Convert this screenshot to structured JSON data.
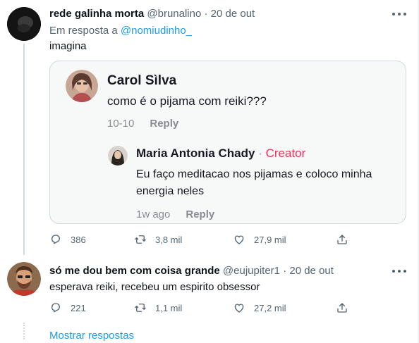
{
  "tweet1": {
    "name": "rede galinha morta",
    "handle": "@brunalino",
    "sep": "·",
    "date": "20 de out",
    "reply_prefix": "Em resposta a",
    "reply_handle": "@nomiudinho_",
    "text": "imagina",
    "media": {
      "comment1": {
        "name": "Carol Sìlva",
        "text": "como é o pijama com reiki???",
        "date": "10-10",
        "reply": "Reply"
      },
      "comment2": {
        "name": "Maria Antonia Chady",
        "dot": "·",
        "creator": "Creator",
        "text": "Eu faço meditacao nos pijamas e coloco minha energia neles",
        "date": "1w ago",
        "reply": "Reply"
      }
    },
    "actions": {
      "replies": "386",
      "retweets": "3,8 mil",
      "likes": "27,9 mil"
    }
  },
  "tweet2": {
    "name": "só me dou bem com coisa grande",
    "handle": "@eujupiter1",
    "sep": "·",
    "date": "20 de out",
    "text": "esperava reiki, recebeu um espirito obsessor",
    "actions": {
      "replies": "221",
      "retweets": "1,1 mil",
      "likes": "27,2 mil"
    }
  },
  "show_replies": "Mostrar respostas",
  "icons": [
    "reply-icon",
    "retweet-icon",
    "like-icon",
    "share-icon",
    "more-icon"
  ],
  "colors": {
    "accent": "#1d9bf0",
    "creator": "#fe2c55",
    "muted": "#536471"
  }
}
